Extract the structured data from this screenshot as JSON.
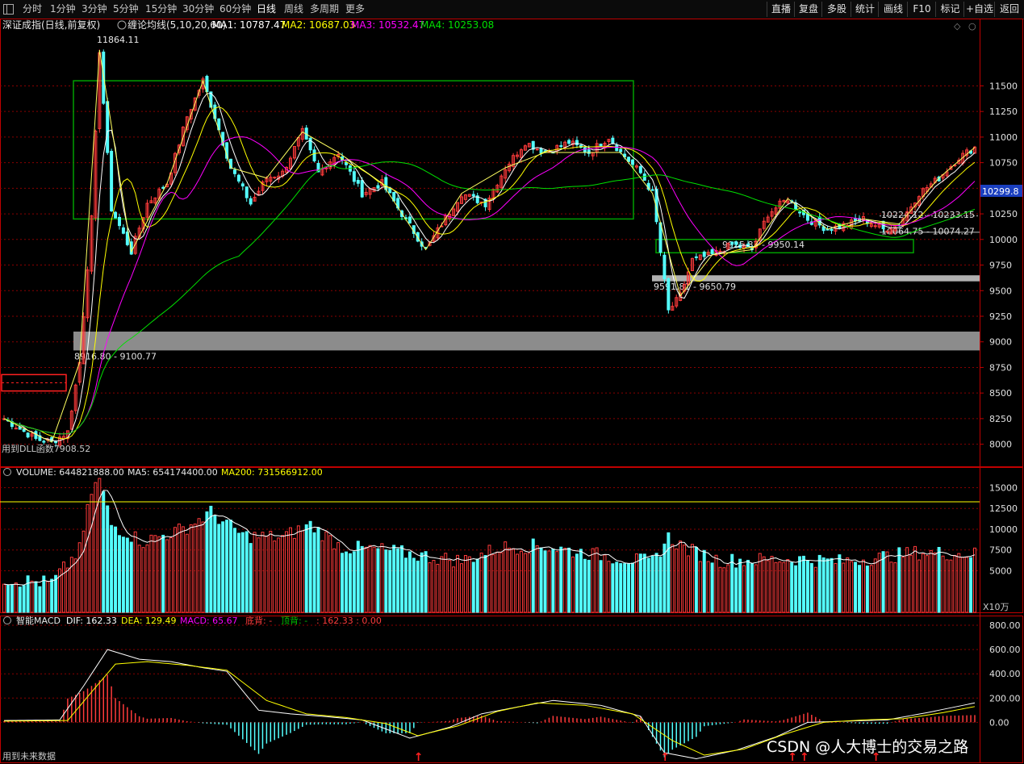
{
  "toolbar": {
    "timeframes": [
      "分时",
      "1分钟",
      "3分钟",
      "5分钟",
      "15分钟",
      "30分钟",
      "60分钟",
      "日线",
      "周线",
      "多周期",
      "更多"
    ],
    "active_timeframe": "日线",
    "right_buttons": [
      "直播",
      "复盘",
      "多股",
      "统计",
      "画线",
      "F10",
      "标记",
      "+自选",
      "返回"
    ]
  },
  "main_panel": {
    "title": "深证成指(日线,前复权)",
    "indicator": "缠论均线(5,10,20,60)",
    "ma1": "MA1: 10787.47",
    "ma2": "MA2: 10687.03",
    "ma3": "MA3: 10532.47",
    "ma4": "MA4: 10253.08",
    "high_label": "11864.11",
    "low_label": "用到DLL函数7908.52",
    "current_price": "10299.8",
    "zones": [
      {
        "label": "8916.80 - 9100.77"
      },
      {
        "label": "9591.81 - 9650.79"
      },
      {
        "label": "9925.87 - 9950.14"
      },
      {
        "label": "10064.75 - 10074.27"
      },
      {
        "label": "10224.12 - 10233.15"
      }
    ]
  },
  "volume_panel": {
    "title": "VOLUME: 644821888.00",
    "ma5": "MA5: 654174400.00",
    "ma200": "MA200: 731566912.00",
    "unit": "X10万"
  },
  "macd_panel": {
    "title": "智能MACD",
    "dif": "DIF: 162.33",
    "dea": "DEA: 129.49",
    "macd": "MACD: 65.67",
    "bottom_div": "底背: -",
    "top_div": "顶背: -",
    "tail": ": 162.33 : 0.00",
    "footer": "用到未来数据"
  },
  "watermark": "CSDN @人大博士的交易之路",
  "colors": {
    "up": "#ff3b3b",
    "down": "#54ffff",
    "ma1": "#ffffff",
    "ma2": "#ffff00",
    "ma3": "#ff00ff",
    "ma4": "#00e000",
    "grid": "#8a0000",
    "axis": "#c00000"
  },
  "chart_data": {
    "type": "candlestick",
    "price_axis_ticks": [
      8000,
      8250,
      8500,
      8750,
      9000,
      9250,
      9500,
      9750,
      10000,
      10250,
      10500,
      10750,
      11000,
      11250,
      11500
    ],
    "price_ylim": [
      7800,
      12000
    ],
    "volume_axis_ticks": [
      5000,
      7500,
      10000,
      12500,
      15000
    ],
    "volume_ylim": [
      0,
      16500
    ],
    "macd_axis_ticks": [
      0.0,
      200.0,
      400.0,
      600.0,
      800.0
    ],
    "macd_ylim": [
      -330,
      880
    ],
    "close_anchors": [
      [
        0,
        8250
      ],
      [
        8,
        8050
      ],
      [
        12,
        8020
      ],
      [
        16,
        8120
      ],
      [
        19,
        8800
      ],
      [
        22,
        10200
      ],
      [
        24,
        11850
      ],
      [
        27,
        10300
      ],
      [
        32,
        9880
      ],
      [
        36,
        10350
      ],
      [
        41,
        10550
      ],
      [
        46,
        11200
      ],
      [
        50,
        11550
      ],
      [
        53,
        11200
      ],
      [
        57,
        10700
      ],
      [
        62,
        10350
      ],
      [
        66,
        10600
      ],
      [
        70,
        10650
      ],
      [
        75,
        11050
      ],
      [
        79,
        10650
      ],
      [
        84,
        10850
      ],
      [
        90,
        10450
      ],
      [
        95,
        10550
      ],
      [
        100,
        10250
      ],
      [
        106,
        9900
      ],
      [
        110,
        10150
      ],
      [
        115,
        10450
      ],
      [
        121,
        10350
      ],
      [
        126,
        10700
      ],
      [
        131,
        10950
      ],
      [
        136,
        10850
      ],
      [
        142,
        10950
      ],
      [
        147,
        10850
      ],
      [
        152,
        11000
      ],
      [
        155,
        10850
      ],
      [
        160,
        10650
      ],
      [
        163,
        10450
      ],
      [
        167,
        9300
      ],
      [
        170,
        9450
      ],
      [
        173,
        9800
      ],
      [
        178,
        9850
      ],
      [
        183,
        9950
      ],
      [
        188,
        9900
      ],
      [
        192,
        10250
      ],
      [
        197,
        10400
      ],
      [
        202,
        10200
      ],
      [
        207,
        10100
      ],
      [
        212,
        10150
      ],
      [
        216,
        10200
      ],
      [
        221,
        10100
      ],
      [
        225,
        10150
      ],
      [
        230,
        10450
      ],
      [
        235,
        10600
      ],
      [
        240,
        10800
      ],
      [
        244,
        10900
      ]
    ],
    "volume_anchors": [
      [
        0,
        4000
      ],
      [
        12,
        3500
      ],
      [
        19,
        7500
      ],
      [
        22,
        14500
      ],
      [
        24,
        16000
      ],
      [
        27,
        10500
      ],
      [
        35,
        8500
      ],
      [
        45,
        10000
      ],
      [
        52,
        12000
      ],
      [
        60,
        9200
      ],
      [
        70,
        9000
      ],
      [
        77,
        10500
      ],
      [
        85,
        7800
      ],
      [
        95,
        7500
      ],
      [
        105,
        6800
      ],
      [
        115,
        6200
      ],
      [
        125,
        7800
      ],
      [
        135,
        8000
      ],
      [
        145,
        7200
      ],
      [
        155,
        6500
      ],
      [
        163,
        6000
      ],
      [
        167,
        9000
      ],
      [
        172,
        7500
      ],
      [
        180,
        6200
      ],
      [
        190,
        6300
      ],
      [
        200,
        6400
      ],
      [
        210,
        6100
      ],
      [
        220,
        6600
      ],
      [
        230,
        7200
      ],
      [
        244,
        7000
      ]
    ],
    "macd_dif_anchors": [
      [
        0,
        15
      ],
      [
        14,
        20
      ],
      [
        20,
        300
      ],
      [
        26,
        600
      ],
      [
        34,
        520
      ],
      [
        42,
        500
      ],
      [
        50,
        450
      ],
      [
        56,
        420
      ],
      [
        64,
        100
      ],
      [
        72,
        70
      ],
      [
        80,
        50
      ],
      [
        90,
        20
      ],
      [
        102,
        -130
      ],
      [
        112,
        -40
      ],
      [
        120,
        70
      ],
      [
        128,
        120
      ],
      [
        138,
        180
      ],
      [
        150,
        140
      ],
      [
        160,
        50
      ],
      [
        166,
        -250
      ],
      [
        174,
        -300
      ],
      [
        184,
        -230
      ],
      [
        194,
        -120
      ],
      [
        202,
        0
      ],
      [
        212,
        10
      ],
      [
        222,
        20
      ],
      [
        232,
        80
      ],
      [
        244,
        160
      ]
    ],
    "macd_dea_anchors": [
      [
        0,
        10
      ],
      [
        16,
        15
      ],
      [
        22,
        250
      ],
      [
        28,
        480
      ],
      [
        36,
        500
      ],
      [
        46,
        470
      ],
      [
        56,
        430
      ],
      [
        66,
        180
      ],
      [
        76,
        70
      ],
      [
        86,
        40
      ],
      [
        96,
        -10
      ],
      [
        104,
        -110
      ],
      [
        114,
        -30
      ],
      [
        124,
        90
      ],
      [
        134,
        160
      ],
      [
        146,
        140
      ],
      [
        158,
        70
      ],
      [
        168,
        -150
      ],
      [
        176,
        -270
      ],
      [
        186,
        -220
      ],
      [
        196,
        -100
      ],
      [
        206,
        0
      ],
      [
        216,
        20
      ],
      [
        226,
        30
      ],
      [
        236,
        80
      ],
      [
        244,
        130
      ]
    ]
  }
}
